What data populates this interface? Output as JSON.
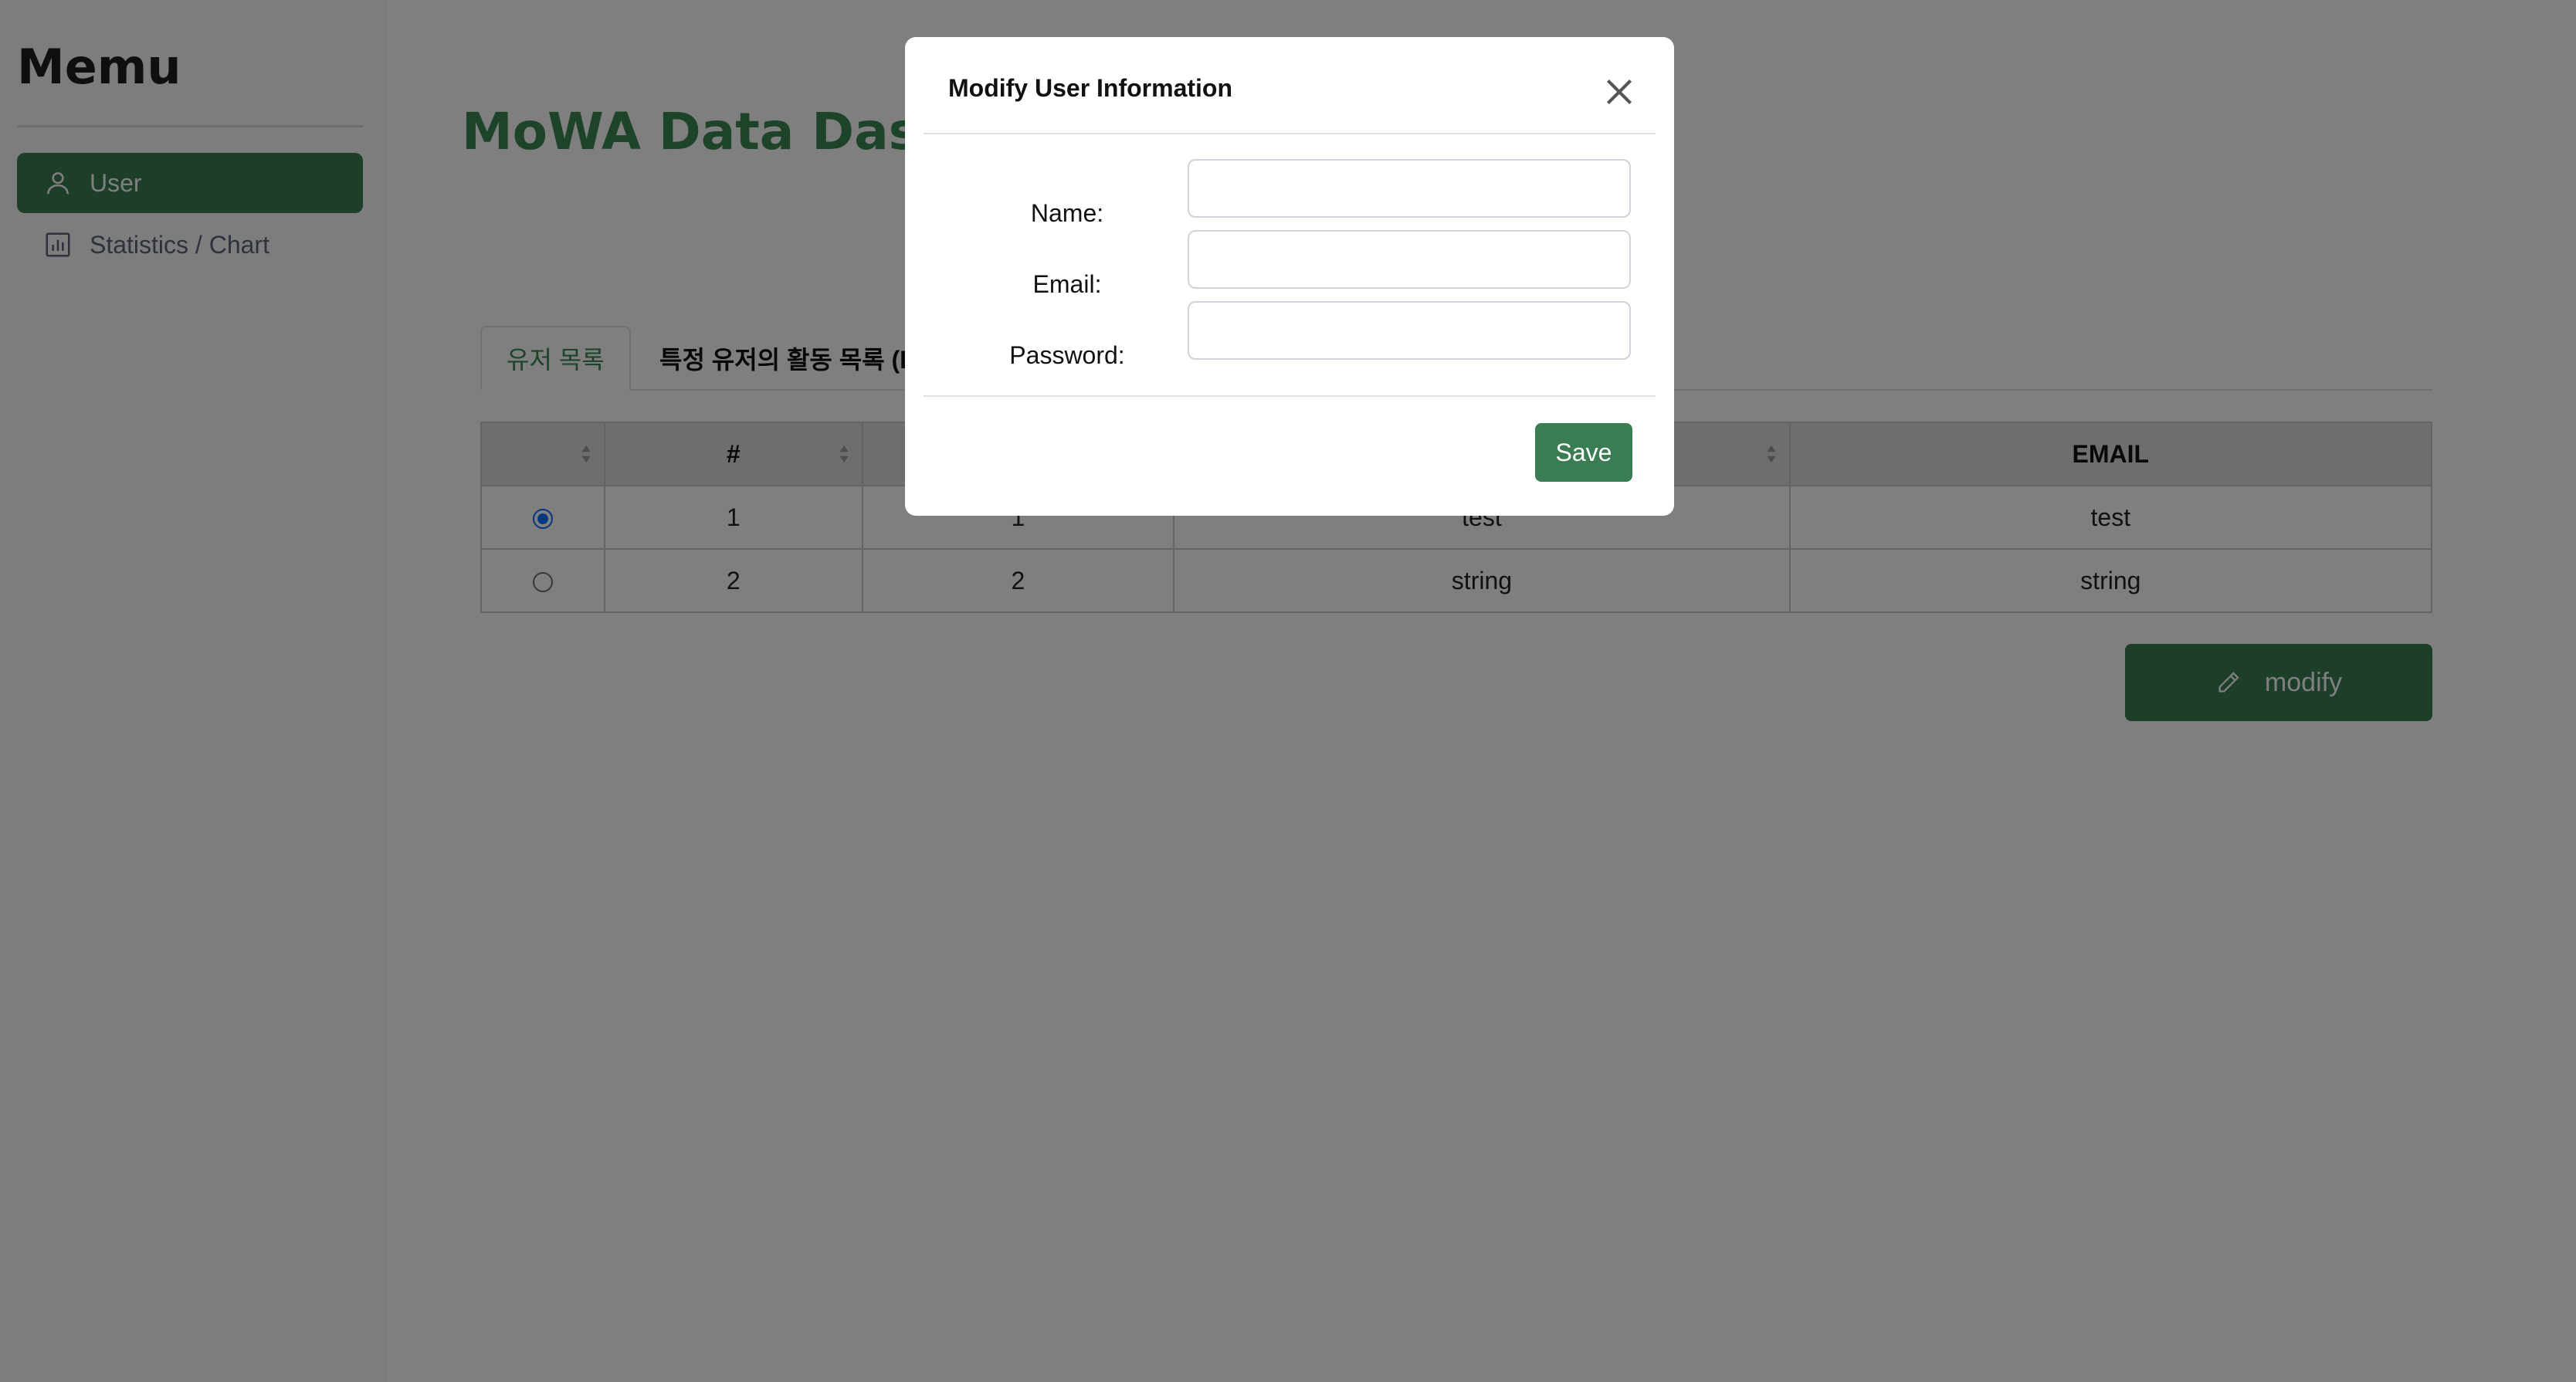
{
  "sidebar": {
    "title": "Memu",
    "items": [
      {
        "label": "User",
        "icon": "user-icon",
        "active": true
      },
      {
        "label": "Statistics / Chart",
        "icon": "bar-chart-icon",
        "active": false
      }
    ]
  },
  "main": {
    "title": "MoWA Data Dashb",
    "tabs": [
      {
        "label": "유저 목록"
      },
      {
        "label": "특정 유저의 활동 목록 (I"
      }
    ],
    "table": {
      "headers": [
        "",
        "#",
        "",
        "",
        "EMAIL"
      ],
      "rows": [
        {
          "selected": true,
          "cells": [
            "1",
            "1",
            "test",
            "test"
          ]
        },
        {
          "selected": false,
          "cells": [
            "2",
            "2",
            "string",
            "string"
          ]
        }
      ]
    },
    "modify_label": "modify"
  },
  "modal": {
    "title": "Modify User Information",
    "fields": [
      {
        "label": "Name:",
        "value": ""
      },
      {
        "label": "Email:",
        "value": ""
      },
      {
        "label": "Password:",
        "value": ""
      }
    ],
    "save_label": "Save"
  },
  "colors": {
    "accent": "#3a7d52",
    "title_green": "#3a8653",
    "overlay": "rgba(0,0,0,0.5)"
  }
}
